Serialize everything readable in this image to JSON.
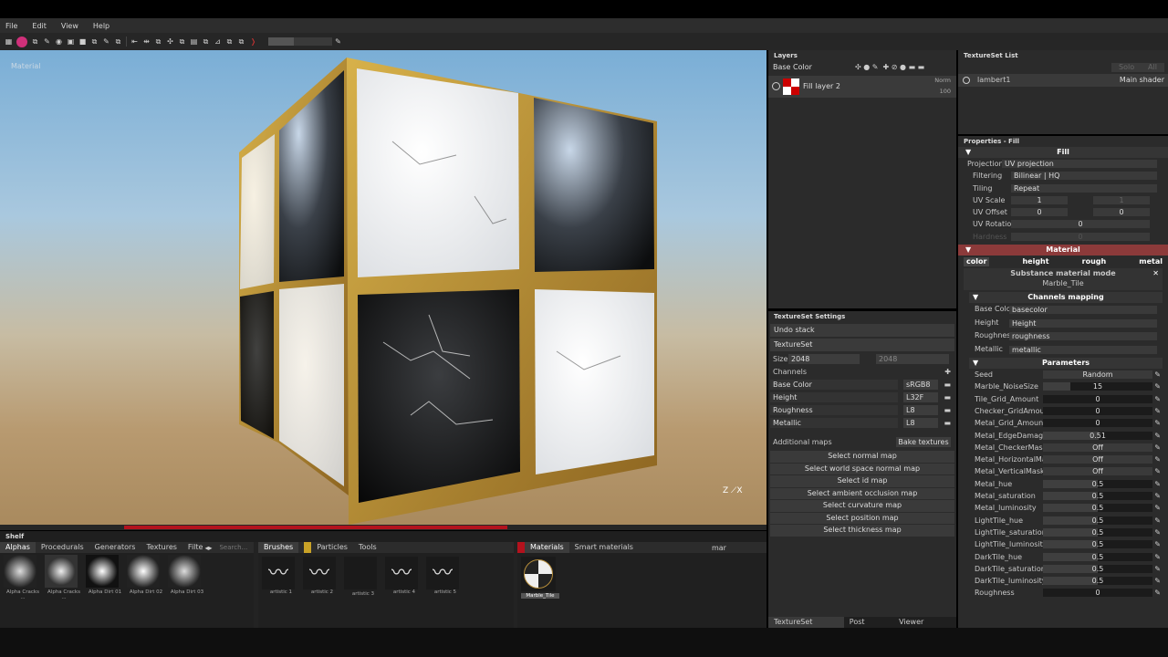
{
  "menu": [
    "File",
    "Edit",
    "View",
    "Help"
  ],
  "viewport": {
    "label": "Material",
    "axis": "Z ⟋X"
  },
  "layers": {
    "title": "Layers",
    "channel": "Base Color",
    "layer_name": "Fill layer 2",
    "blend": "Norm",
    "opacity": "100"
  },
  "texset_list": {
    "title": "TextureSet List",
    "solo": "Solo",
    "all": "All",
    "item": "lambert1",
    "shader": "Main shader"
  },
  "texset_settings": {
    "title": "TextureSet Settings",
    "undo": "Undo stack",
    "name": "TextureSet",
    "size_label": "Size",
    "size1": "2048",
    "size2": "2048",
    "channels_label": "Channels",
    "channels": [
      {
        "name": "Base Color",
        "fmt": "sRGB8"
      },
      {
        "name": "Height",
        "fmt": "L32F"
      },
      {
        "name": "Roughness",
        "fmt": "L8"
      },
      {
        "name": "Metallic",
        "fmt": "L8"
      }
    ],
    "additional": "Additional maps",
    "bake": "Bake textures",
    "maps": [
      "Select normal map",
      "Select world space normal map",
      "Select id map",
      "Select ambient occlusion map",
      "Select curvature map",
      "Select position map",
      "Select thickness map"
    ],
    "tabs": [
      "TextureSet Settings",
      "Post Effects",
      "Viewer Settings"
    ]
  },
  "props": {
    "title": "Properties - Fill",
    "fill": "Fill",
    "projection_label": "Projection",
    "projection": "UV projection",
    "filtering_label": "Filtering",
    "filtering": "Bilinear | HQ",
    "tiling_label": "Tiling",
    "tiling": "Repeat",
    "uvscale_label": "UV Scale",
    "uvscale": "1",
    "uvscale2": "1",
    "uvoffset_label": "UV Offset",
    "uvoffset": "0",
    "uvoffset2": "0",
    "uvrot_label": "UV Rotation",
    "uvrot": "0",
    "hardness_label": "Hardness",
    "hardness": "0",
    "material": "Material",
    "channels": [
      "color",
      "height",
      "rough",
      "metal"
    ],
    "mode_title": "Substance material mode",
    "mode_value": "Marble_Tile",
    "mapping_title": "Channels mapping",
    "mapping": [
      {
        "label": "Base Color",
        "value": "basecolor"
      },
      {
        "label": "Height",
        "value": "Height"
      },
      {
        "label": "Roughness",
        "value": "roughness"
      },
      {
        "label": "Metallic",
        "value": "metallic"
      }
    ],
    "params_title": "Parameters",
    "params": [
      {
        "label": "Seed",
        "value": "Random",
        "kind": "button"
      },
      {
        "label": "Marble_NoiseSize",
        "value": "15",
        "frac": 0.25
      },
      {
        "label": "Tile_Grid_Amount",
        "value": "0",
        "frac": 0
      },
      {
        "label": "Checker_GridAmount",
        "value": "0",
        "frac": 0
      },
      {
        "label": "Metal_Grid_Amount",
        "value": "0",
        "frac": 0
      },
      {
        "label": "Metal_EdgeDamage",
        "value": "0.51",
        "frac": 0.51
      },
      {
        "label": "Metal_CheckerMask",
        "value": "Off",
        "kind": "button"
      },
      {
        "label": "Metal_HorizontalMask",
        "value": "Off",
        "kind": "button"
      },
      {
        "label": "Metal_VerticalMask",
        "value": "Off",
        "kind": "button"
      },
      {
        "label": "Metal_hue",
        "value": "0.5",
        "frac": 0.5
      },
      {
        "label": "Metal_saturation",
        "value": "0.5",
        "frac": 0.5
      },
      {
        "label": "Metal_luminosity",
        "value": "0.5",
        "frac": 0.5
      },
      {
        "label": "LightTile_hue",
        "value": "0.5",
        "frac": 0.5
      },
      {
        "label": "LightTile_saturation",
        "value": "0.5",
        "frac": 0.5
      },
      {
        "label": "LightTile_luminosity",
        "value": "0.5",
        "frac": 0.5
      },
      {
        "label": "DarkTile_hue",
        "value": "0.5",
        "frac": 0.5
      },
      {
        "label": "DarkTile_saturation",
        "value": "0.5",
        "frac": 0.5
      },
      {
        "label": "DarkTile_luminosity",
        "value": "0.5",
        "frac": 0.5
      },
      {
        "label": "Roughness",
        "value": "0",
        "frac": 0
      }
    ]
  },
  "shelf": {
    "title": "Shelf",
    "tabs1": [
      "Alphas",
      "Procedurals",
      "Generators",
      "Textures",
      "Filte"
    ],
    "search": "Search...",
    "alphas": [
      "Alpha Cracks ...",
      "Alpha Cracks ...",
      "Alpha Dirt 01",
      "Alpha Dirt 02",
      "Alpha Dirt 03"
    ],
    "tabs2": [
      "Brushes",
      "Particles",
      "Tools"
    ],
    "brushes": [
      "artistic 1",
      "artistic 2",
      "artistic 3",
      "artistic 4",
      "artistic 5"
    ],
    "tabs3": [
      "Materials",
      "Smart materials"
    ],
    "mat_search": "mar",
    "material": "Marble_Tile"
  },
  "colors": {
    "accent": "#b3121d",
    "material_header": "#8c3a3a"
  }
}
